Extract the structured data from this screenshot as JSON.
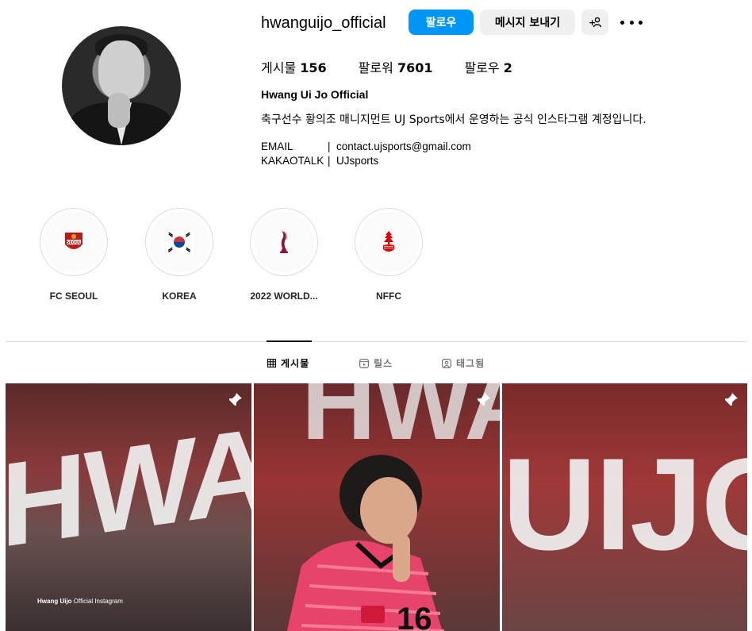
{
  "profile": {
    "username": "hwanguijo_official",
    "follow_label": "팔로우",
    "message_label": "메시지 보내기",
    "add_person_label": "+⚇",
    "stats": {
      "posts_label": "게시물",
      "posts_value": "156",
      "followers_label": "팔로워",
      "followers_value": "7601",
      "following_label": "팔로우",
      "following_value": "2"
    },
    "bio_name": "Hwang Ui Jo Official",
    "bio_desc": "축구선수 황의조 매니지먼트 UJ Sports에서 운영하는 공식 인스타그램 계정입니다.",
    "email_key": "EMAIL",
    "email_sep": "|",
    "email_value": "contact.ujsports@gmail.com",
    "kakao_key": "KAKAOTALK",
    "kakao_sep": "|",
    "kakao_value": "UJsports"
  },
  "highlights": [
    {
      "label": "FC SEOUL",
      "icon": "fc-seoul-crest-icon"
    },
    {
      "label": "KOREA",
      "icon": "korea-flag-icon"
    },
    {
      "label": "2022 WORLD...",
      "icon": "world-cup-trophy-icon"
    },
    {
      "label": "NFFC",
      "icon": "nffc-crest-icon"
    }
  ],
  "tabs": {
    "posts": "게시물",
    "reels": "릴스",
    "tagged": "태그됨"
  },
  "posts": [
    {
      "text": "HWANG",
      "caption_bold": "Hwang Uijo",
      "caption_rest": " Official Instagram",
      "pinned": true
    },
    {
      "text": "HWANG",
      "pinned": true,
      "jersey_number": "16"
    },
    {
      "text": "UIJO",
      "pinned": true
    }
  ],
  "colors": {
    "accent": "#0095f6",
    "button_bg": "#efefef",
    "divider": "#dbdbdb"
  }
}
